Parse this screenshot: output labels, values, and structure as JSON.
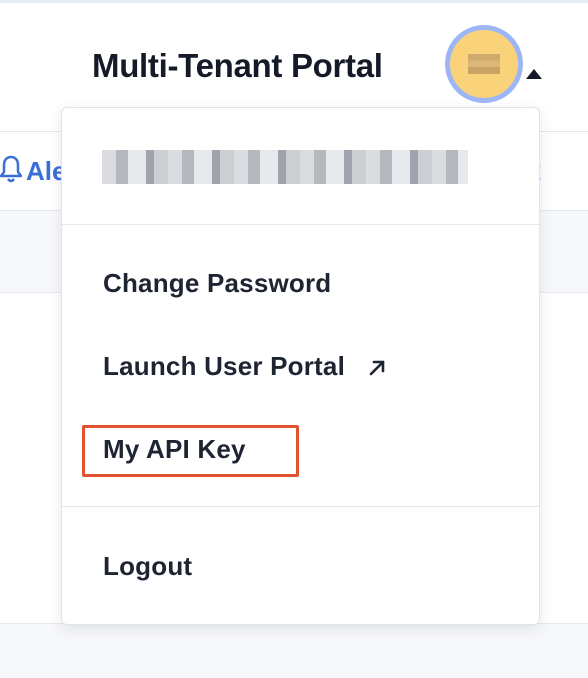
{
  "header": {
    "title": "Multi-Tenant Portal",
    "avatar_icon": "user-avatar",
    "caret_icon": "caret-up-icon"
  },
  "nav": {
    "left_partial": "Ale",
    "right_partial": "t",
    "bell_icon": "bell-icon"
  },
  "dropdown": {
    "menu_items": [
      {
        "label": "Change Password"
      },
      {
        "label": "Launch User Portal",
        "icon": "external-link-icon"
      },
      {
        "label": "My API Key",
        "highlighted": true
      },
      {
        "label": "Logout"
      }
    ]
  },
  "colors": {
    "accent": "#3b6fd8",
    "avatar_fill": "#f9d27a",
    "avatar_ring": "#9db6f5",
    "highlight": "#e2522f"
  }
}
